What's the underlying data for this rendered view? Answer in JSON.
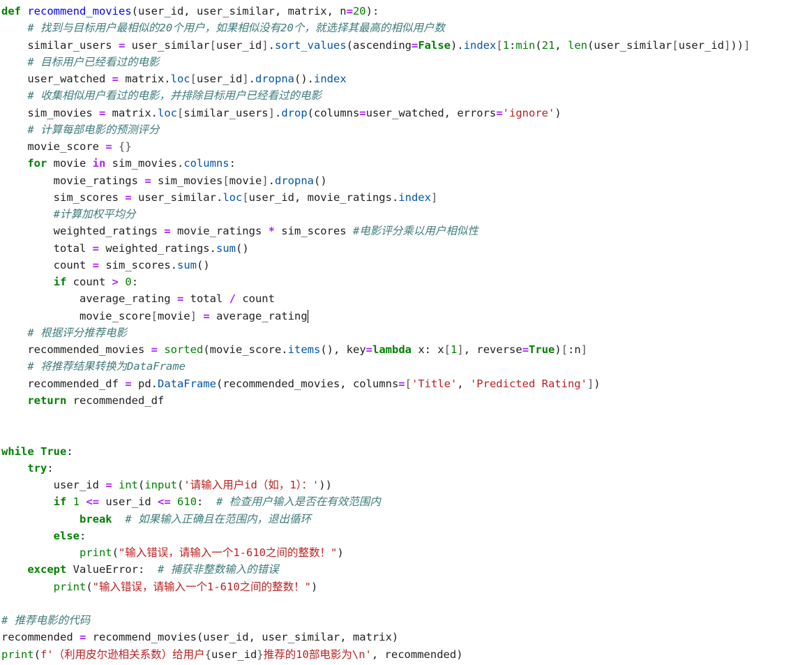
{
  "editor": {
    "cursor_line": 19,
    "lines": [
      [
        [
          "kw",
          "def"
        ],
        [
          "p",
          " "
        ],
        [
          "def",
          "recommend_movies"
        ],
        [
          "p",
          "(user_id, user_similar, matrix, n"
        ],
        [
          "op",
          "="
        ],
        [
          "num",
          "20"
        ],
        [
          "p",
          "):"
        ]
      ],
      [
        [
          "p",
          "    "
        ],
        [
          "com",
          "# 找到与目标用户最相似的20个用户，如果相似没有20个，就选择其最高的相似用户数"
        ]
      ],
      [
        [
          "p",
          "    similar_users "
        ],
        [
          "op",
          "="
        ],
        [
          "p",
          " user_similar"
        ],
        [
          "brk",
          "["
        ],
        [
          "p",
          "user_id"
        ],
        [
          "brk",
          "]"
        ],
        [
          "p",
          "."
        ],
        [
          "attr",
          "sort_values"
        ],
        [
          "p",
          "(ascending"
        ],
        [
          "op",
          "="
        ],
        [
          "kw",
          "False"
        ],
        [
          "p",
          ")."
        ],
        [
          "attr",
          "index"
        ],
        [
          "brk",
          "["
        ],
        [
          "num",
          "1"
        ],
        [
          "p",
          ":"
        ],
        [
          "builtin",
          "min"
        ],
        [
          "p",
          "("
        ],
        [
          "num",
          "21"
        ],
        [
          "p",
          ", "
        ],
        [
          "builtin",
          "len"
        ],
        [
          "p",
          "(user_similar"
        ],
        [
          "brk",
          "["
        ],
        [
          "p",
          "user_id"
        ],
        [
          "brk",
          "]"
        ],
        [
          "p",
          "))"
        ],
        [
          "brk",
          "]"
        ]
      ],
      [
        [
          "p",
          "    "
        ],
        [
          "com",
          "# 目标用户已经看过的电影"
        ]
      ],
      [
        [
          "p",
          "    user_watched "
        ],
        [
          "op",
          "="
        ],
        [
          "p",
          " matrix."
        ],
        [
          "attr",
          "loc"
        ],
        [
          "brk",
          "["
        ],
        [
          "p",
          "user_id"
        ],
        [
          "brk",
          "]"
        ],
        [
          "p",
          "."
        ],
        [
          "attr",
          "dropna"
        ],
        [
          "p",
          "()."
        ],
        [
          "attr",
          "index"
        ]
      ],
      [
        [
          "p",
          "    "
        ],
        [
          "com",
          "# 收集相似用户看过的电影，并排除目标用户已经看过的电影"
        ]
      ],
      [
        [
          "p",
          "    sim_movies "
        ],
        [
          "op",
          "="
        ],
        [
          "p",
          " matrix."
        ],
        [
          "attr",
          "loc"
        ],
        [
          "brk",
          "["
        ],
        [
          "p",
          "similar_users"
        ],
        [
          "brk",
          "]"
        ],
        [
          "p",
          "."
        ],
        [
          "attr",
          "drop"
        ],
        [
          "p",
          "(columns"
        ],
        [
          "op",
          "="
        ],
        [
          "p",
          "user_watched, errors"
        ],
        [
          "op",
          "="
        ],
        [
          "str",
          "'ignore'"
        ],
        [
          "p",
          ")"
        ]
      ],
      [
        [
          "p",
          "    "
        ],
        [
          "com",
          "# 计算每部电影的预测评分"
        ]
      ],
      [
        [
          "p",
          "    movie_score "
        ],
        [
          "op",
          "="
        ],
        [
          "p",
          " "
        ],
        [
          "brk",
          "{}"
        ]
      ],
      [
        [
          "p",
          "    "
        ],
        [
          "kw",
          "for"
        ],
        [
          "p",
          " movie "
        ],
        [
          "op",
          "in"
        ],
        [
          "p",
          " sim_movies."
        ],
        [
          "attr",
          "columns"
        ],
        [
          "p",
          ":"
        ]
      ],
      [
        [
          "p",
          "        movie_ratings "
        ],
        [
          "op",
          "="
        ],
        [
          "p",
          " sim_movies"
        ],
        [
          "brk",
          "["
        ],
        [
          "p",
          "movie"
        ],
        [
          "brk",
          "]"
        ],
        [
          "p",
          "."
        ],
        [
          "attr",
          "dropna"
        ],
        [
          "p",
          "()"
        ]
      ],
      [
        [
          "p",
          "        sim_scores "
        ],
        [
          "op",
          "="
        ],
        [
          "p",
          " user_similar."
        ],
        [
          "attr",
          "loc"
        ],
        [
          "brk",
          "["
        ],
        [
          "p",
          "user_id, movie_ratings."
        ],
        [
          "attr",
          "index"
        ],
        [
          "brk",
          "]"
        ]
      ],
      [
        [
          "p",
          "        "
        ],
        [
          "com",
          "#计算加权平均分"
        ]
      ],
      [
        [
          "p",
          "        weighted_ratings "
        ],
        [
          "op",
          "="
        ],
        [
          "p",
          " movie_ratings "
        ],
        [
          "op",
          "*"
        ],
        [
          "p",
          " sim_scores "
        ],
        [
          "com",
          "#电影评分乘以用户相似性"
        ]
      ],
      [
        [
          "p",
          "        total "
        ],
        [
          "op",
          "="
        ],
        [
          "p",
          " weighted_ratings."
        ],
        [
          "attr",
          "sum"
        ],
        [
          "p",
          "()"
        ]
      ],
      [
        [
          "p",
          "        count "
        ],
        [
          "op",
          "="
        ],
        [
          "p",
          " sim_scores."
        ],
        [
          "attr",
          "sum"
        ],
        [
          "p",
          "()"
        ]
      ],
      [
        [
          "p",
          "        "
        ],
        [
          "kw",
          "if"
        ],
        [
          "p",
          " count "
        ],
        [
          "op",
          ">"
        ],
        [
          "p",
          " "
        ],
        [
          "num",
          "0"
        ],
        [
          "p",
          ":"
        ]
      ],
      [
        [
          "p",
          "            average_rating "
        ],
        [
          "op",
          "="
        ],
        [
          "p",
          " total "
        ],
        [
          "op",
          "/"
        ],
        [
          "p",
          " count"
        ]
      ],
      [
        [
          "p",
          "            movie_score"
        ],
        [
          "brk",
          "["
        ],
        [
          "p",
          "movie"
        ],
        [
          "brk",
          "]"
        ],
        [
          "p",
          " "
        ],
        [
          "op",
          "="
        ],
        [
          "p",
          " average_rating"
        ]
      ],
      [
        [
          "p",
          "    "
        ],
        [
          "com",
          "# 根据评分推荐电影"
        ]
      ],
      [
        [
          "p",
          "    recommended_movies "
        ],
        [
          "op",
          "="
        ],
        [
          "p",
          " "
        ],
        [
          "builtin",
          "sorted"
        ],
        [
          "p",
          "(movie_score."
        ],
        [
          "attr",
          "items"
        ],
        [
          "p",
          "(), key"
        ],
        [
          "op",
          "="
        ],
        [
          "kw",
          "lambda"
        ],
        [
          "p",
          " x: x"
        ],
        [
          "brk",
          "["
        ],
        [
          "num",
          "1"
        ],
        [
          "brk",
          "]"
        ],
        [
          "p",
          ", reverse"
        ],
        [
          "op",
          "="
        ],
        [
          "kw",
          "True"
        ],
        [
          "p",
          ")"
        ],
        [
          "brk",
          "["
        ],
        [
          "p",
          ":n"
        ],
        [
          "brk",
          "]"
        ]
      ],
      [
        [
          "p",
          "    "
        ],
        [
          "com",
          "# 将推荐结果转换为DataFrame"
        ]
      ],
      [
        [
          "p",
          "    recommended_df "
        ],
        [
          "op",
          "="
        ],
        [
          "p",
          " pd."
        ],
        [
          "attr",
          "DataFrame"
        ],
        [
          "p",
          "(recommended_movies, columns"
        ],
        [
          "op",
          "="
        ],
        [
          "brk",
          "["
        ],
        [
          "str",
          "'Title'"
        ],
        [
          "p",
          ", "
        ],
        [
          "str",
          "'Predicted Rating'"
        ],
        [
          "brk",
          "]"
        ],
        [
          "p",
          ")"
        ]
      ],
      [
        [
          "p",
          "    "
        ],
        [
          "kw",
          "return"
        ],
        [
          "p",
          " recommended_df"
        ]
      ],
      [],
      [],
      [
        [
          "kw",
          "while"
        ],
        [
          "p",
          " "
        ],
        [
          "kw",
          "True"
        ],
        [
          "p",
          ":"
        ]
      ],
      [
        [
          "p",
          "    "
        ],
        [
          "kw",
          "try"
        ],
        [
          "p",
          ":"
        ]
      ],
      [
        [
          "p",
          "        user_id "
        ],
        [
          "op",
          "="
        ],
        [
          "p",
          " "
        ],
        [
          "builtin",
          "int"
        ],
        [
          "p",
          "("
        ],
        [
          "builtin",
          "input"
        ],
        [
          "p",
          "("
        ],
        [
          "str",
          "'请输入用户id（如，1）：'"
        ],
        [
          "p",
          "))"
        ]
      ],
      [
        [
          "p",
          "        "
        ],
        [
          "kw",
          "if"
        ],
        [
          "p",
          " "
        ],
        [
          "num",
          "1"
        ],
        [
          "p",
          " "
        ],
        [
          "op",
          "<="
        ],
        [
          "p",
          " user_id "
        ],
        [
          "op",
          "<="
        ],
        [
          "p",
          " "
        ],
        [
          "num",
          "610"
        ],
        [
          "p",
          ":  "
        ],
        [
          "com",
          "# 检查用户输入是否在有效范围内"
        ]
      ],
      [
        [
          "p",
          "            "
        ],
        [
          "kw",
          "break"
        ],
        [
          "p",
          "  "
        ],
        [
          "com",
          "# 如果输入正确且在范围内，退出循环"
        ]
      ],
      [
        [
          "p",
          "        "
        ],
        [
          "kw",
          "else"
        ],
        [
          "p",
          ":"
        ]
      ],
      [
        [
          "p",
          "            "
        ],
        [
          "builtin",
          "print"
        ],
        [
          "p",
          "("
        ],
        [
          "str",
          "\"输入错误，请输入一个1-610之间的整数！\""
        ],
        [
          "p",
          ")"
        ]
      ],
      [
        [
          "p",
          "    "
        ],
        [
          "kw",
          "except"
        ],
        [
          "p",
          " ValueError:  "
        ],
        [
          "com",
          "# 捕获非整数输入的错误"
        ]
      ],
      [
        [
          "p",
          "        "
        ],
        [
          "builtin",
          "print"
        ],
        [
          "p",
          "("
        ],
        [
          "str",
          "\"输入错误，请输入一个1-610之间的整数！\""
        ],
        [
          "p",
          ")"
        ]
      ],
      [],
      [
        [
          "com",
          "# 推荐电影的代码"
        ]
      ],
      [
        [
          "p",
          "recommended "
        ],
        [
          "op",
          "="
        ],
        [
          "p",
          " recommend_movies(user_id, user_similar, matrix)"
        ]
      ],
      [
        [
          "builtin",
          "print"
        ],
        [
          "p",
          "("
        ],
        [
          "str",
          "f'（利用皮尔逊相关系数）给用户"
        ],
        [
          "brk",
          "{"
        ],
        [
          "p",
          "user_id"
        ],
        [
          "brk",
          "}"
        ],
        [
          "str",
          "推荐的10部电影为\\n'"
        ],
        [
          "p",
          ", recommended)"
        ]
      ]
    ]
  }
}
